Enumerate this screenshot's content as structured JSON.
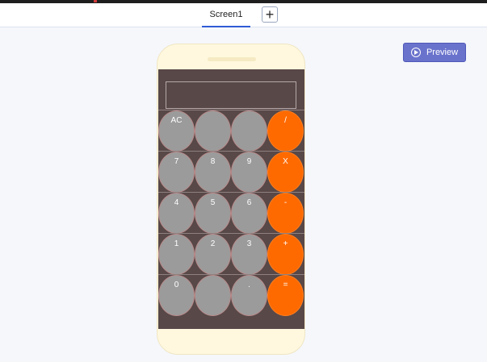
{
  "tabbar": {
    "tab_label": "Screen1",
    "add_label": "+"
  },
  "toolbar": {
    "preview_label": "Preview"
  },
  "calculator": {
    "rows": [
      [
        "AC",
        "",
        "",
        "/"
      ],
      [
        "7",
        "8",
        "9",
        "X"
      ],
      [
        "4",
        "5",
        "6",
        "-"
      ],
      [
        "1",
        "2",
        "3",
        "+"
      ],
      [
        "0",
        "",
        ".",
        "="
      ]
    ]
  },
  "colors": {
    "accent": "#2e5bd6",
    "preview_button": "#6a73cc",
    "phone_body": "#fff8de",
    "screen_bg": "#584848",
    "digit_button": "#9b9b9b",
    "operator_button": "#ff6a00"
  }
}
